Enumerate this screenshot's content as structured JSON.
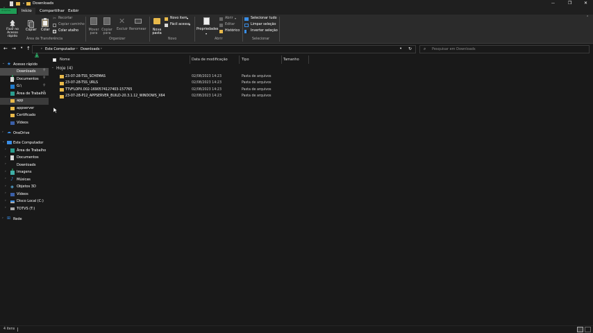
{
  "window": {
    "title": "Downloads",
    "controls": {
      "minimize": "—",
      "maximize": "❐",
      "close": "✕"
    }
  },
  "ribbon": {
    "file_tab": "Arquivo",
    "tabs": [
      "Início",
      "Compartilhar",
      "Exibir"
    ],
    "clipboard": {
      "pin_quick": "Fixar no Acesso rápido",
      "copy": "Copiar",
      "paste": "Colar",
      "cut": "Recortar",
      "copy_path": "Copiar caminho",
      "paste_shortcut": "Colar atalho",
      "group": "Área de Transferência"
    },
    "organize": {
      "move_to": "Mover para",
      "copy_to": "Copiar para",
      "delete": "Excluir",
      "rename": "Renomear",
      "group": "Organizar"
    },
    "new": {
      "new_folder": "Nova pasta",
      "new_item": "Novo item",
      "easy_access": "Fácil acesso",
      "group": "Novo"
    },
    "open": {
      "properties": "Propriedades",
      "open": "Abrir",
      "edit": "Editar",
      "history": "Histórico",
      "group": "Abrir"
    },
    "select": {
      "select_all": "Selecionar tudo",
      "select_none": "Limpar seleção",
      "invert": "Inverter seleção",
      "group": "Selecionar"
    }
  },
  "address": {
    "path": [
      "Este Computador",
      "Downloads"
    ],
    "search_placeholder": "Pesquisar em Downloads"
  },
  "nav": {
    "quick_access": "Acesso rápido",
    "quick_items": [
      "Downloads",
      "Documentos",
      "G:\\",
      "Área de Trabalho",
      "app",
      "appserver",
      "Certificado",
      "Vídeos"
    ],
    "onedrive": "OneDrive",
    "this_pc": "Este Computador",
    "pc_items": [
      "Área de Trabalho",
      "Documentos",
      "Downloads",
      "Imagens",
      "Músicas",
      "Objetos 3D",
      "Vídeos",
      "Disco Local (C:)",
      "TOTVS (T:)"
    ],
    "network": "Rede"
  },
  "columns": [
    "Nome",
    "Data de modificação",
    "Tipo",
    "Tamanho"
  ],
  "group": {
    "label": "Hoje (4)"
  },
  "files": [
    {
      "name": "23-07-28-TSS_SCHEMAS",
      "date": "02/08/2023 14:23",
      "type": "Pasta de arquivos"
    },
    {
      "name": "23-07-28-TSS_URLS",
      "date": "02/08/2023 14:23",
      "type": "Pasta de arquivos"
    },
    {
      "name": "TTVFLOPX.002-1690574127403-157765",
      "date": "02/08/2023 14:23",
      "type": "Pasta de arquivos"
    },
    {
      "name": "23-07-28-P12_APPSERVER_BUILD-20.3.1.12_WINDOWS_X64",
      "date": "02/08/2023 14:23",
      "type": "Pasta de arquivos"
    }
  ],
  "status": {
    "count": "4 itens"
  },
  "colors": {
    "accent": "#1f9d55",
    "folder": "#e8b94a",
    "background": "#191919",
    "ribbon": "#2b2b2b"
  }
}
